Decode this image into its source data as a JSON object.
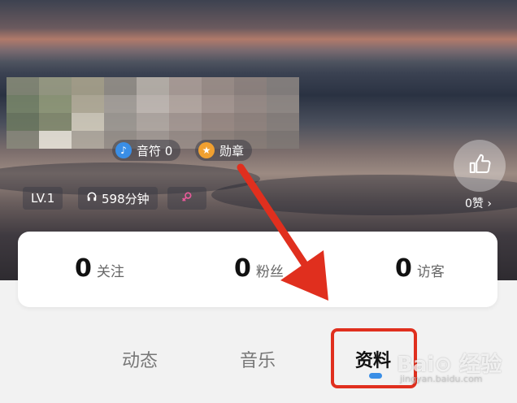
{
  "profile": {
    "badges": [
      {
        "icon": "music-note-icon",
        "label": "音符 0",
        "color": "#3a8ee6"
      },
      {
        "icon": "star-medal-icon",
        "label": "勋章",
        "color": "#f0a030"
      }
    ],
    "level": "LV.1",
    "listen_time": "598分钟",
    "like_count": "0赞 ›"
  },
  "stats": [
    {
      "value": "0",
      "label": "关注"
    },
    {
      "value": "0",
      "label": "粉丝"
    },
    {
      "value": "0",
      "label": "访客"
    }
  ],
  "tabs": [
    {
      "label": "动态"
    },
    {
      "label": "音乐"
    },
    {
      "label": "资料",
      "active": true
    }
  ],
  "colors": {
    "accent": "#3a8ee6",
    "highlight": "#e02f1e"
  },
  "watermark": {
    "title": "Bai⊙ 经验",
    "url": "jingyan.baidu.com"
  }
}
